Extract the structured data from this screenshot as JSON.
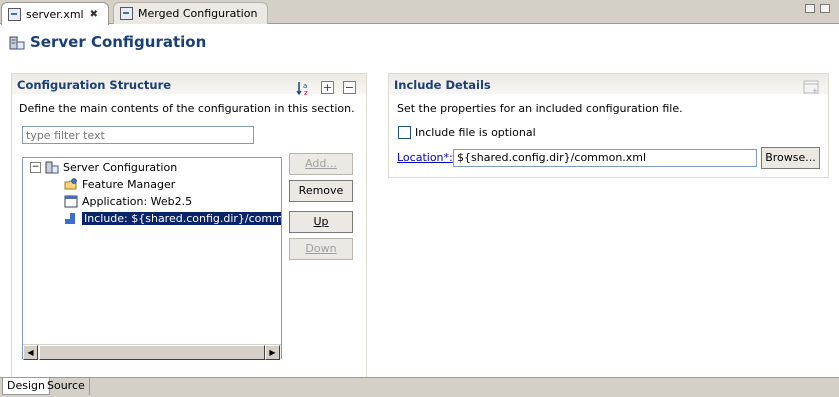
{
  "tabs": [
    {
      "label": "server.xml",
      "close": "✖"
    },
    {
      "label": "Merged Configuration"
    }
  ],
  "form_title": "Server Configuration",
  "left_section": {
    "title": "Configuration Structure",
    "description": "Define the main contents of the configuration in this section.",
    "filter_placeholder": "type filter text",
    "tree": [
      {
        "label": "Server Configuration",
        "icon": "server-config-icon"
      },
      {
        "label": "Feature Manager",
        "icon": "folder-icon"
      },
      {
        "label": "Application: Web2.5",
        "icon": "application-icon"
      },
      {
        "label": "Include: ${shared.config.dir}/common.xml",
        "icon": "include-icon",
        "selected": true
      }
    ],
    "buttons": {
      "add": "Add...",
      "remove": "Remove",
      "up": "Up",
      "down": "Down"
    },
    "tools": {
      "sort": "sort-alpha-icon",
      "expand": "expand-all-icon",
      "collapse": "collapse-all-icon"
    }
  },
  "right_section": {
    "title": "Include Details",
    "description": "Set the properties for an included configuration file.",
    "optional_label": "Include file is optional",
    "optional_checked": false,
    "location_label": "Location*:",
    "location_value": "${shared.config.dir}/common.xml",
    "browse_label": "Browse..."
  },
  "bottom_tabs": {
    "design": "Design",
    "source": "Source"
  },
  "colors": {
    "title": "#1b3f79",
    "selection": "#0a246a",
    "link": "#0000cc"
  }
}
